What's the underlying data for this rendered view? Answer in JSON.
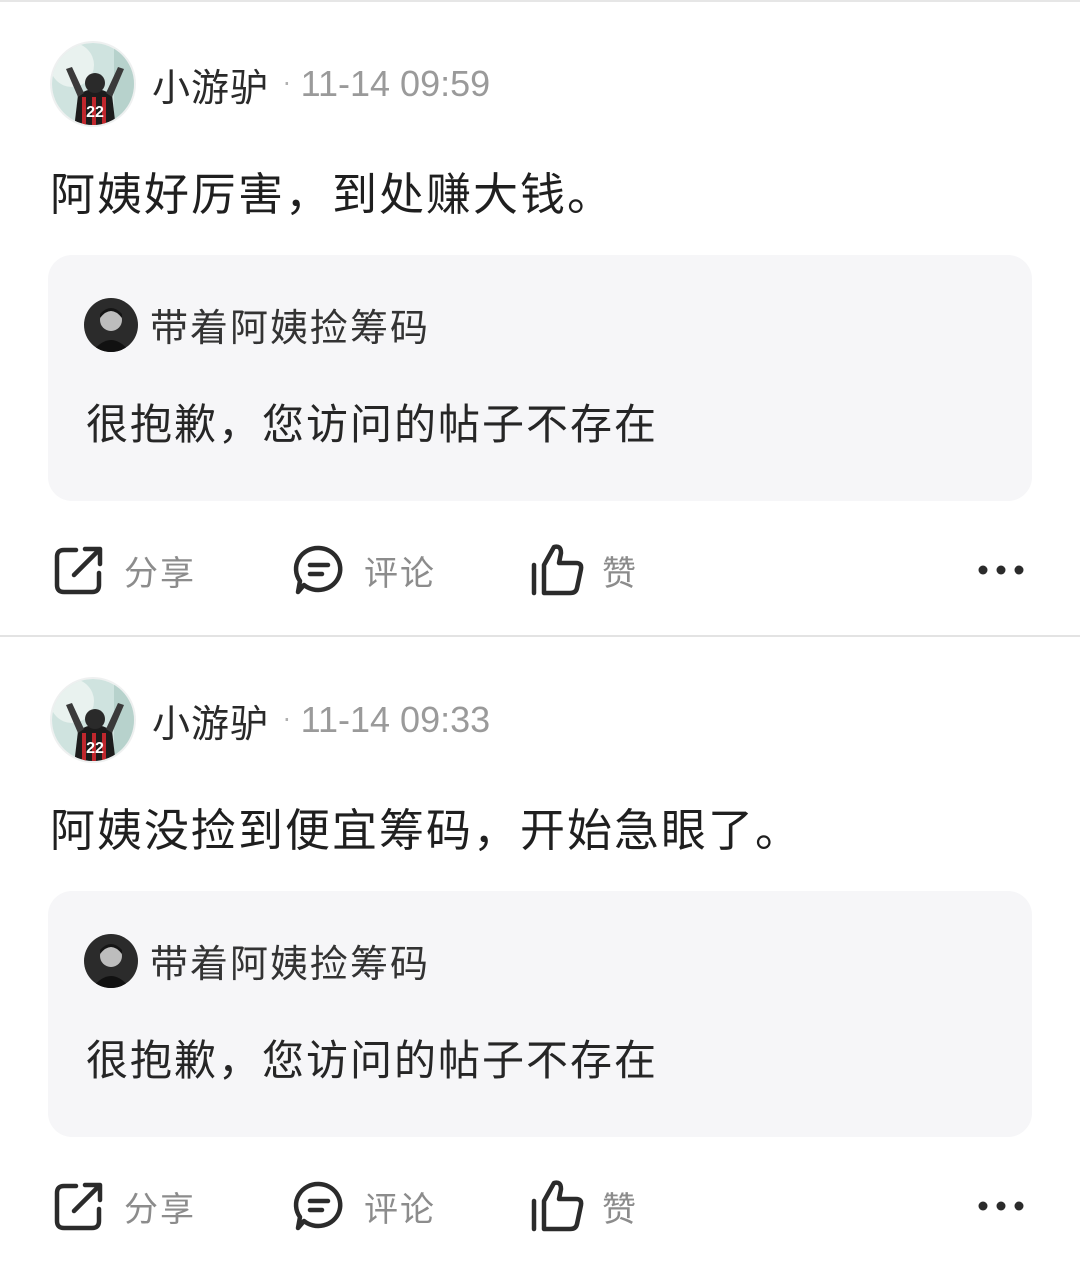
{
  "posts": [
    {
      "author": "小游驴",
      "dot": "·",
      "time": "11-14 09:59",
      "avatar_icon": "football-player-avatar-icon",
      "text": "阿姨好厉害，到处赚大钱。",
      "quote": {
        "author": "带着阿姨捡筹码",
        "avatar_icon": "user-portrait-avatar-icon",
        "text": "很抱歉，您访问的帖子不存在"
      },
      "actions": {
        "share": "分享",
        "comment": "评论",
        "like": "赞"
      }
    },
    {
      "author": "小游驴",
      "dot": "·",
      "time": "11-14 09:33",
      "avatar_icon": "football-player-avatar-icon",
      "text": "阿姨没捡到便宜筹码，开始急眼了。",
      "quote": {
        "author": "带着阿姨捡筹码",
        "avatar_icon": "user-portrait-avatar-icon",
        "text": "很抱歉，您访问的帖子不存在"
      },
      "actions": {
        "share": "分享",
        "comment": "评论",
        "like": "赞"
      }
    }
  ],
  "colors": {
    "quote_background": "#f6f6f8",
    "secondary_text": "#9a9a9a",
    "icon_stroke": "#2b2b2b"
  }
}
